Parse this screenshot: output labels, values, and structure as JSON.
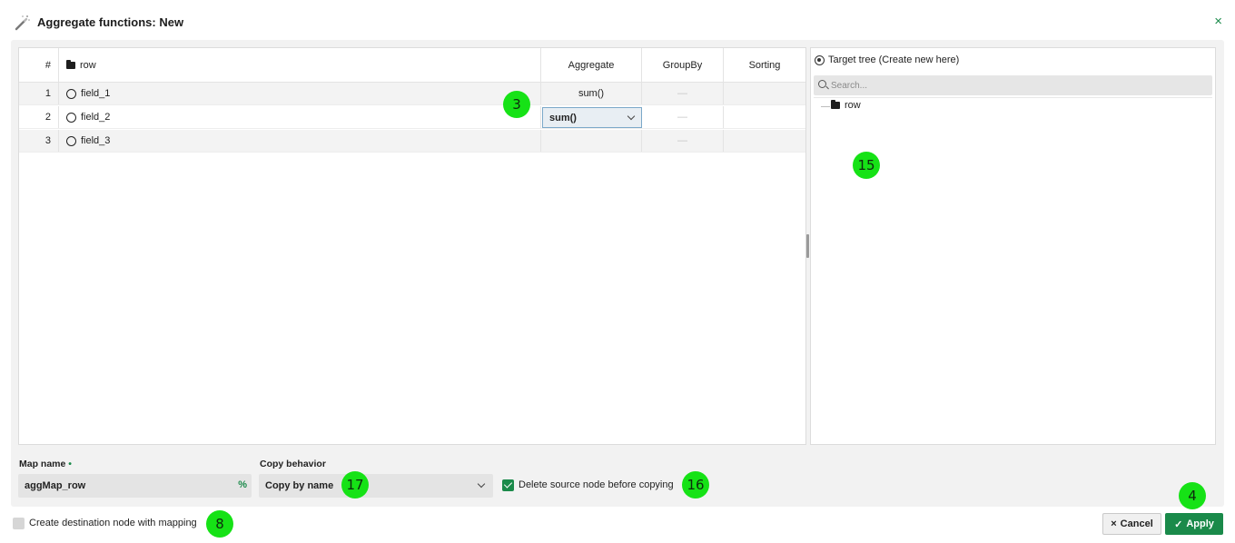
{
  "window": {
    "title": "Aggregate functions: New",
    "close_glyph": "×",
    "title_icon": "magic-wand-icon"
  },
  "grid": {
    "headers": {
      "num": "#",
      "name": "row",
      "aggregate": "Aggregate",
      "groupby": "GroupBy",
      "sorting": "Sorting"
    },
    "rows": [
      {
        "num": "1",
        "name": "field_1",
        "aggregate": "sum()",
        "groupby": "—",
        "sorting": ""
      },
      {
        "num": "2",
        "name": "field_2",
        "aggregate": "sum()",
        "groupby": "—",
        "sorting": ""
      },
      {
        "num": "3",
        "name": "field_3",
        "aggregate": "",
        "groupby": "—",
        "sorting": ""
      }
    ]
  },
  "target_tree": {
    "label": "Target tree (Create new here)",
    "search_placeholder": "Search...",
    "root_node": "row"
  },
  "form": {
    "map_name_label": "Map name",
    "required_mark": "•",
    "map_name_value": "aggMap_row",
    "percent_glyph": "%",
    "copy_behavior_label": "Copy behavior",
    "copy_behavior_value": "Copy by name",
    "delete_source_label": "Delete source node before copying",
    "delete_source_checked": true,
    "create_dest_label": "Create destination node with mapping",
    "create_dest_checked": false
  },
  "buttons": {
    "cancel_glyph": "×",
    "cancel": "Cancel",
    "apply_glyph": "✓",
    "apply": "Apply"
  },
  "markers": {
    "m3": "3",
    "m15": "15",
    "m17": "17",
    "m16": "16",
    "m4": "4",
    "m8": "8"
  },
  "colors": {
    "accent": "#1a8a4a",
    "marker": "#16e216",
    "selected_cell_border": "#7ba8c9"
  }
}
